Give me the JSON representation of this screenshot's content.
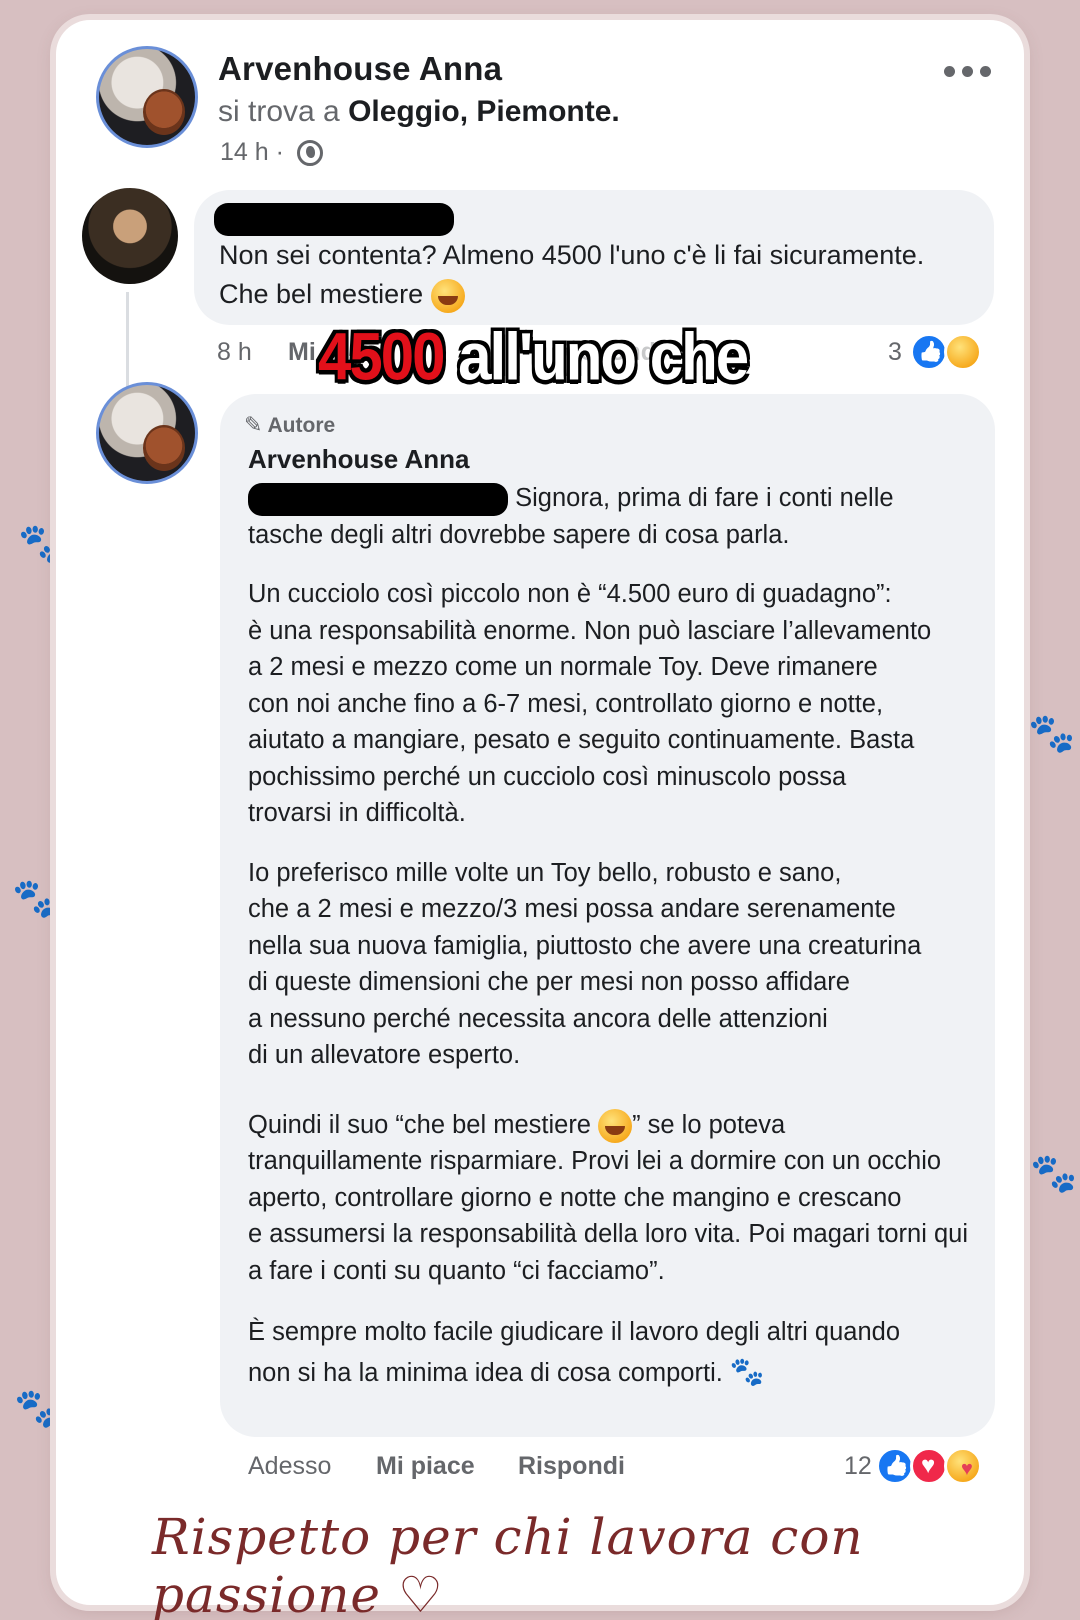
{
  "post": {
    "author": "Arvenhouse Anna",
    "location_prefix": "si trova a ",
    "location": "Oleggio, Piemonte.",
    "time": "14 h",
    "separator": "·"
  },
  "comment": {
    "text_line1": "Non sei contenta? Almeno 4500 l'uno c'è li fai sicuramente.",
    "text_line2": "Che bel mestiere",
    "time": "8 h",
    "like_label": "Mi",
    "reply_label": "Rispondi",
    "reaction_count": "3",
    "reactions": [
      "like",
      "haha"
    ]
  },
  "overlay_caption": {
    "red": "4500",
    "white": " all'uno che"
  },
  "reply": {
    "badge": "Autore",
    "author": "Arvenhouse Anna",
    "p1_rest": "Signora, prima di fare i conti nelle",
    "p1_line2": "tasche degli altri dovrebbe sapere di cosa parla.",
    "p2": [
      "Un cucciolo così piccolo non è “4.500 euro di guadagno”:",
      "è una responsabilità enorme. Non può lasciare l’allevamento",
      "a 2 mesi e mezzo come un normale Toy. Deve rimanere",
      "con noi anche fino a 6-7 mesi, controllato giorno e notte,",
      "aiutato a mangiare, pesato e seguito continuamente. Basta",
      "pochissimo perché un cucciolo così minuscolo possa",
      "trovarsi in difficoltà."
    ],
    "p3": [
      "Io preferisco mille volte un Toy bello, robusto e sano,",
      "che a 2 mesi e mezzo/3 mesi possa andare serenamente",
      "nella sua nuova famiglia, piuttosto che avere una creaturina",
      "di queste dimensioni che per mesi non posso affidare",
      "a nessuno perché necessita ancora delle attenzioni",
      "di un allevatore esperto."
    ],
    "p4_start": "Quindi il suo “che bel mestiere",
    "p4_end": "” se lo poteva",
    "p4": [
      "tranquillamente risparmiare. Provi lei a dormire con un occhio",
      "aperto, controllare giorno e notte che mangino e crescano",
      "e assumersi la responsabilità della loro vita. Poi magari torni qui",
      "a fare i conti su quanto “ci facciamo”."
    ],
    "p5_line1": "È sempre molto facile giudicare il lavoro degli altri quando",
    "p5_line2": "non si ha la minima idea di cosa comporti.",
    "time": "Adesso",
    "like_label": "Mi piace",
    "reply_label": "Rispondi",
    "reaction_count": "12",
    "reactions": [
      "like",
      "love",
      "care"
    ]
  },
  "footer": {
    "text": "Rispetto per chi lavora con passione"
  },
  "colors": {
    "background": "#d7bfc1",
    "bubble": "#f0f2f5",
    "facebook_blue": "#1877f2",
    "overlay_red": "#e2101a"
  }
}
